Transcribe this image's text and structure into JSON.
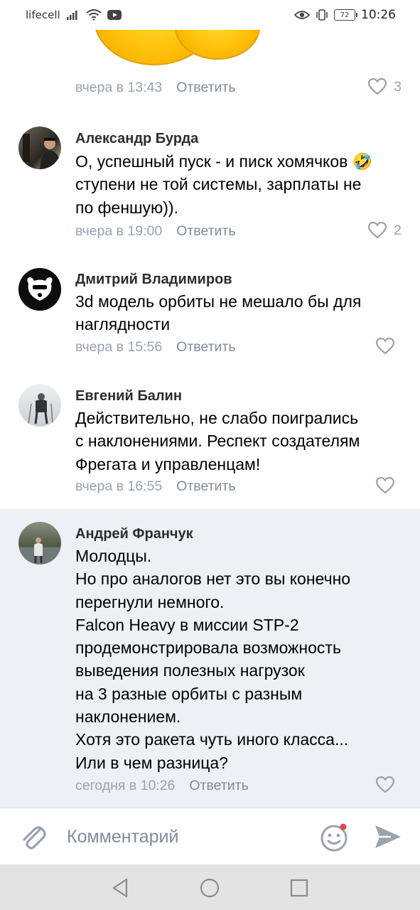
{
  "status_bar": {
    "carrier": "lifecell",
    "battery": "72",
    "time": "10:26"
  },
  "first_meta": {
    "time": "вчера в 13:43",
    "reply": "Ответить",
    "likes": "3"
  },
  "comments": [
    {
      "author": "Александр Бурда",
      "text": "О, успешный пуск - и писк хомячков 🤣\nступени не той системы, зарплаты не\nпо феншую)).",
      "time": "вчера в 19:00",
      "reply": "Ответить",
      "likes": "2"
    },
    {
      "author": "Дмитрий Владимиров",
      "text": "3d модель орбиты не мешало бы для\nнаглядности",
      "time": "вчера в 15:56",
      "reply": "Ответить",
      "likes": ""
    },
    {
      "author": "Евгений Балин",
      "text": "Действительно, не слабо поигрались\nс наклонениями. Респект создателям\nФрегата и управленцам!",
      "time": "вчера в 16:55",
      "reply": "Ответить",
      "likes": ""
    },
    {
      "author": "Андрей Франчук",
      "text": "Молодцы.\nНо про аналогов нет это вы конечно\nперегнули немного.\nFalcon Heavy в миссии STP-2\nпродемонстрировала возможность\nвыведения полезных нагрузок\nна 3 разные орбиты с разным\nнаклонением.\nХотя это ракета чуть иного класса...\nИли в чем разница?",
      "time": "сегодня в 10:26",
      "reply": "Ответить",
      "likes": ""
    }
  ],
  "composer": {
    "placeholder": "Комментарий"
  },
  "colors": {
    "accent": "#818c99",
    "highlight_bg": "#edf0f5",
    "notification_dot": "#e64646"
  },
  "icons": {
    "attach": "paperclip-icon",
    "emoji": "smile-icon",
    "send": "send-icon",
    "like": "heart-icon"
  }
}
